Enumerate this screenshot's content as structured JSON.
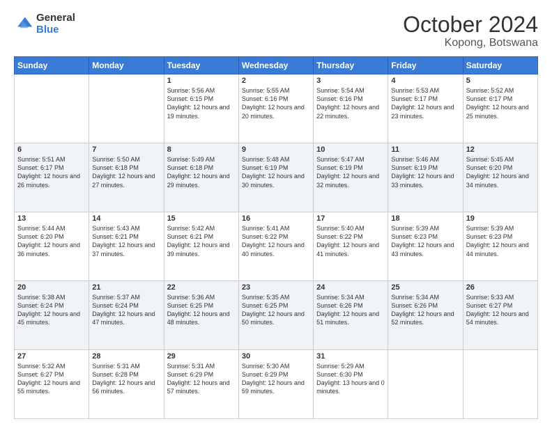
{
  "header": {
    "logo_line1": "General",
    "logo_line2": "Blue",
    "title": "October 2024",
    "subtitle": "Kopong, Botswana"
  },
  "days_of_week": [
    "Sunday",
    "Monday",
    "Tuesday",
    "Wednesday",
    "Thursday",
    "Friday",
    "Saturday"
  ],
  "weeks": [
    [
      {
        "day": "",
        "info": ""
      },
      {
        "day": "",
        "info": ""
      },
      {
        "day": "1",
        "info": "Sunrise: 5:56 AM\nSunset: 6:15 PM\nDaylight: 12 hours and 19 minutes."
      },
      {
        "day": "2",
        "info": "Sunrise: 5:55 AM\nSunset: 6:16 PM\nDaylight: 12 hours and 20 minutes."
      },
      {
        "day": "3",
        "info": "Sunrise: 5:54 AM\nSunset: 6:16 PM\nDaylight: 12 hours and 22 minutes."
      },
      {
        "day": "4",
        "info": "Sunrise: 5:53 AM\nSunset: 6:17 PM\nDaylight: 12 hours and 23 minutes."
      },
      {
        "day": "5",
        "info": "Sunrise: 5:52 AM\nSunset: 6:17 PM\nDaylight: 12 hours and 25 minutes."
      }
    ],
    [
      {
        "day": "6",
        "info": "Sunrise: 5:51 AM\nSunset: 6:17 PM\nDaylight: 12 hours and 26 minutes."
      },
      {
        "day": "7",
        "info": "Sunrise: 5:50 AM\nSunset: 6:18 PM\nDaylight: 12 hours and 27 minutes."
      },
      {
        "day": "8",
        "info": "Sunrise: 5:49 AM\nSunset: 6:18 PM\nDaylight: 12 hours and 29 minutes."
      },
      {
        "day": "9",
        "info": "Sunrise: 5:48 AM\nSunset: 6:19 PM\nDaylight: 12 hours and 30 minutes."
      },
      {
        "day": "10",
        "info": "Sunrise: 5:47 AM\nSunset: 6:19 PM\nDaylight: 12 hours and 32 minutes."
      },
      {
        "day": "11",
        "info": "Sunrise: 5:46 AM\nSunset: 6:19 PM\nDaylight: 12 hours and 33 minutes."
      },
      {
        "day": "12",
        "info": "Sunrise: 5:45 AM\nSunset: 6:20 PM\nDaylight: 12 hours and 34 minutes."
      }
    ],
    [
      {
        "day": "13",
        "info": "Sunrise: 5:44 AM\nSunset: 6:20 PM\nDaylight: 12 hours and 36 minutes."
      },
      {
        "day": "14",
        "info": "Sunrise: 5:43 AM\nSunset: 6:21 PM\nDaylight: 12 hours and 37 minutes."
      },
      {
        "day": "15",
        "info": "Sunrise: 5:42 AM\nSunset: 6:21 PM\nDaylight: 12 hours and 39 minutes."
      },
      {
        "day": "16",
        "info": "Sunrise: 5:41 AM\nSunset: 6:22 PM\nDaylight: 12 hours and 40 minutes."
      },
      {
        "day": "17",
        "info": "Sunrise: 5:40 AM\nSunset: 6:22 PM\nDaylight: 12 hours and 41 minutes."
      },
      {
        "day": "18",
        "info": "Sunrise: 5:39 AM\nSunset: 6:23 PM\nDaylight: 12 hours and 43 minutes."
      },
      {
        "day": "19",
        "info": "Sunrise: 5:39 AM\nSunset: 6:23 PM\nDaylight: 12 hours and 44 minutes."
      }
    ],
    [
      {
        "day": "20",
        "info": "Sunrise: 5:38 AM\nSunset: 6:24 PM\nDaylight: 12 hours and 45 minutes."
      },
      {
        "day": "21",
        "info": "Sunrise: 5:37 AM\nSunset: 6:24 PM\nDaylight: 12 hours and 47 minutes."
      },
      {
        "day": "22",
        "info": "Sunrise: 5:36 AM\nSunset: 6:25 PM\nDaylight: 12 hours and 48 minutes."
      },
      {
        "day": "23",
        "info": "Sunrise: 5:35 AM\nSunset: 6:25 PM\nDaylight: 12 hours and 50 minutes."
      },
      {
        "day": "24",
        "info": "Sunrise: 5:34 AM\nSunset: 6:26 PM\nDaylight: 12 hours and 51 minutes."
      },
      {
        "day": "25",
        "info": "Sunrise: 5:34 AM\nSunset: 6:26 PM\nDaylight: 12 hours and 52 minutes."
      },
      {
        "day": "26",
        "info": "Sunrise: 5:33 AM\nSunset: 6:27 PM\nDaylight: 12 hours and 54 minutes."
      }
    ],
    [
      {
        "day": "27",
        "info": "Sunrise: 5:32 AM\nSunset: 6:27 PM\nDaylight: 12 hours and 55 minutes."
      },
      {
        "day": "28",
        "info": "Sunrise: 5:31 AM\nSunset: 6:28 PM\nDaylight: 12 hours and 56 minutes."
      },
      {
        "day": "29",
        "info": "Sunrise: 5:31 AM\nSunset: 6:29 PM\nDaylight: 12 hours and 57 minutes."
      },
      {
        "day": "30",
        "info": "Sunrise: 5:30 AM\nSunset: 6:29 PM\nDaylight: 12 hours and 59 minutes."
      },
      {
        "day": "31",
        "info": "Sunrise: 5:29 AM\nSunset: 6:30 PM\nDaylight: 13 hours and 0 minutes."
      },
      {
        "day": "",
        "info": ""
      },
      {
        "day": "",
        "info": ""
      }
    ]
  ]
}
